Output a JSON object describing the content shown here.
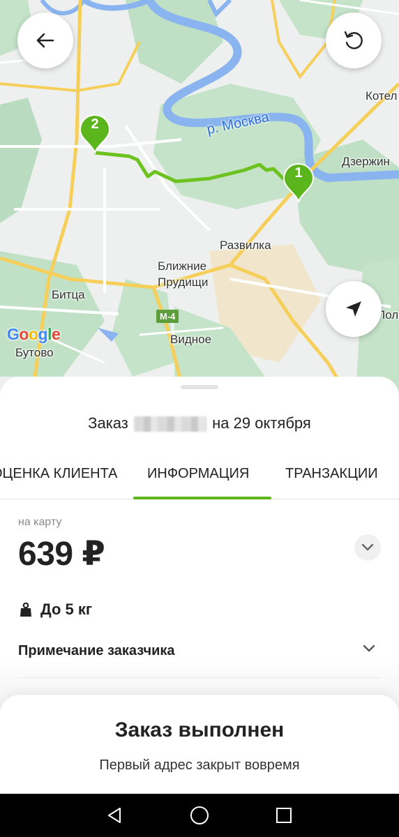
{
  "map": {
    "labels": {
      "kotel": "Котел",
      "dzerzh": "Дзержин",
      "razvilka": "Развилка",
      "blizhnie_1": "Ближние",
      "blizhnie_2": "Прудищи",
      "bitsa": "Битца",
      "vidnoe": "Видное",
      "butovo": "Бутово",
      "pole": "Поле",
      "river": "р. Москва",
      "road_shield": "М-4"
    },
    "google_letters": [
      "G",
      "o",
      "o",
      "g",
      "l",
      "e"
    ],
    "pins": [
      {
        "number": "1",
        "color": "#5bb51c"
      },
      {
        "number": "2",
        "color": "#5bb51c"
      }
    ],
    "route_color": "#6cc21f",
    "buttons": {
      "back_icon": "arrow-left-icon",
      "refresh_icon": "refresh-icon",
      "locate_icon": "navigation-arrow-icon"
    }
  },
  "order": {
    "title_prefix": "Заказ",
    "title_suffix": "на 29 октября"
  },
  "tabs": [
    {
      "label": "ОЦЕНКА КЛИЕНТА"
    },
    {
      "label": "ИНФОРМАЦИЯ",
      "active": true
    },
    {
      "label": "ТРАНЗАКЦИИ"
    }
  ],
  "payment": {
    "method": "на карту",
    "amount": "639 ₽"
  },
  "weight": {
    "icon": "weight-icon",
    "label": "До 5 кг"
  },
  "note": {
    "label": "Примечание заказчика"
  },
  "status": {
    "title": "Заказ выполнен",
    "subtitle": "Первый адрес закрыт вовремя"
  },
  "colors": {
    "accent": "#5bb51c"
  }
}
